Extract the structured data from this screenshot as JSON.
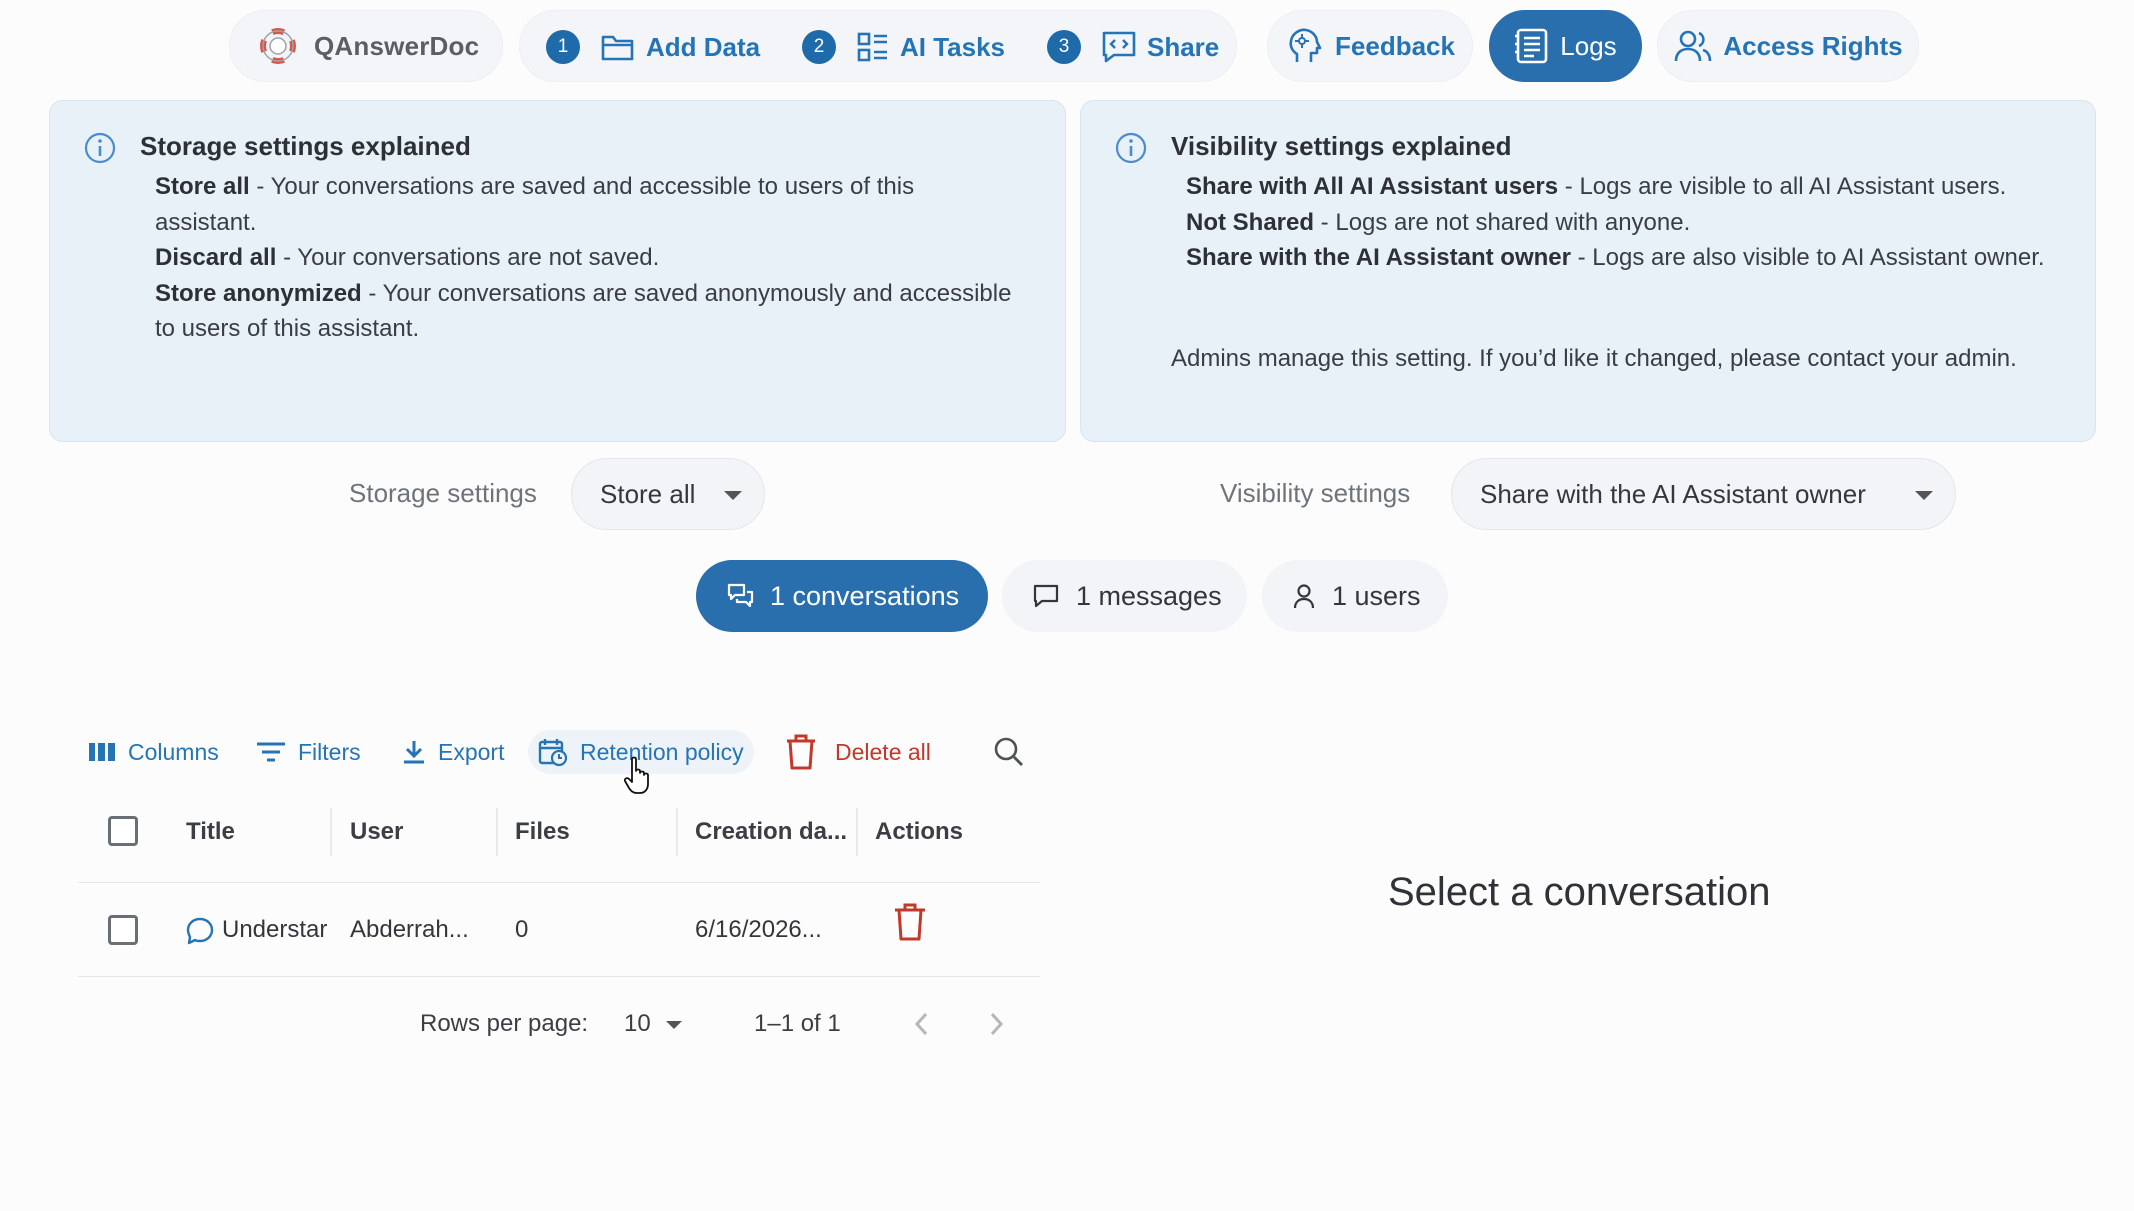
{
  "nav": {
    "brand": "QAnswerDoc",
    "steps": [
      {
        "number": "1",
        "label": "Add Data"
      },
      {
        "number": "2",
        "label": "AI Tasks"
      },
      {
        "number": "3",
        "label": "Share"
      }
    ],
    "feedback": "Feedback",
    "logs": "Logs",
    "access_rights": "Access Rights"
  },
  "storage_panel": {
    "title": "Storage settings explained",
    "items": [
      {
        "term": "Store all",
        "desc": " - Your conversations are saved and accessible to users of this assistant."
      },
      {
        "term": "Discard all",
        "desc": " - Your conversations are not saved."
      },
      {
        "term": "Store anonymized",
        "desc": " - Your conversations are saved anonymously and accessible to users of this assistant."
      }
    ]
  },
  "visibility_panel": {
    "title": "Visibility settings explained",
    "items": [
      {
        "term": "Share with All AI Assistant users",
        "desc": " - Logs are visible to all AI Assistant users."
      },
      {
        "term": "Not Shared",
        "desc": " - Logs are not shared with anyone."
      },
      {
        "term": "Share with the AI Assistant owner",
        "desc": " - Logs are also visible to AI Assistant owner."
      }
    ],
    "note": "Admins manage this setting. If you’d like it changed, please contact your admin."
  },
  "settings": {
    "storage_label": "Storage settings",
    "storage_value": "Store all",
    "visibility_label": "Visibility settings",
    "visibility_value": "Share with the AI Assistant owner"
  },
  "stats": {
    "conversations": "1 conversations",
    "messages": "1 messages",
    "users": "1 users"
  },
  "toolbar": {
    "columns": "Columns",
    "filters": "Filters",
    "export": "Export",
    "retention": "Retention policy",
    "delete_all": "Delete all"
  },
  "table": {
    "headers": {
      "title": "Title",
      "user": "User",
      "files": "Files",
      "created": "Creation da...",
      "actions": "Actions"
    },
    "rows": [
      {
        "title": "Understar",
        "user": "Abderrah...",
        "files": "0",
        "created": "6/16/2026..."
      }
    ]
  },
  "pagination": {
    "rows_label": "Rows per page:",
    "rows_value": "10",
    "range": "1–1 of 1"
  },
  "detail": {
    "empty": "Select a conversation"
  },
  "colors": {
    "accent": "#2a6fad",
    "link": "#2574b5",
    "danger": "#c0392b",
    "panel_bg": "#e8f0f8"
  }
}
